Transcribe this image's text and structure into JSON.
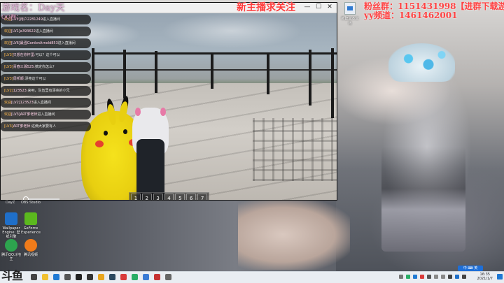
{
  "overlay": {
    "top_left": "游戏名：Day天",
    "top_left_sub": "QQ群：",
    "title_center": "新主播求关注",
    "qq_line": "粉丝群：1151431998【进群下载游戏】",
    "yy_line": "yy频道：1461462001"
  },
  "game_window": {
    "minimize": "—",
    "maximize": "☐",
    "close": "✕"
  },
  "hotbar": [
    "1",
    "2",
    "3",
    "4",
    "5",
    "6",
    "7"
  ],
  "chat": [
    {
      "lvl": "欢迎",
      "nick": "[LV2]用户2281249",
      "text": "进入直播间"
    },
    {
      "lvl": "欢迎",
      "nick": "[LV1]a393622",
      "text": "进入直播间"
    },
    {
      "lvl": "欢迎",
      "nick": "[LV6]最强GordonArnold853",
      "text": "进入直播间"
    },
    {
      "lvl": "[LV3]",
      "nick": "只想在你怀里:",
      "text": "可以？这个可以"
    },
    {
      "lvl": "[LV3]",
      "nick": "青春三湘525:",
      "text": "搞定你怎么？"
    },
    {
      "lvl": "[LV3]",
      "nick": "周邦顺:",
      "text": "漂亮这个可以"
    },
    {
      "lvl": "[LV2]",
      "nick": "123523:",
      "text": "来吧，队伍里有漂亮的小兄"
    },
    {
      "lvl": "欢迎",
      "nick": "[LV2]123523",
      "text": "进入直播间"
    },
    {
      "lvl": "欢迎",
      "nick": "[LV3]ART爹老师",
      "text": "进入直播间"
    },
    {
      "lvl": "[LV3]",
      "nick": "ART爹老师:",
      "text": "这俩大家要有人"
    }
  ],
  "desktop": {
    "day_label": "DayZ",
    "obs_label": "OBS Studio",
    "icons": [
      {
        "label": "Wallpaper Engine: 壁纸引擎",
        "color": "#1f6fc9"
      },
      {
        "label": "GeForce Experience",
        "color": "#5bb81e"
      },
      {
        "label": "腾讯QQ斗地主",
        "color": "#2da44e"
      },
      {
        "label": "腾讯视频",
        "color": "#f07b1a"
      }
    ],
    "file_icon_label": "新建文本文档"
  },
  "taskbar": {
    "start_label": "斗鱼",
    "ime": "中 ⌨ 英",
    "time": "16:35",
    "date": "2021/1/7",
    "apps": [
      {
        "name": "search-app",
        "color": "#444"
      },
      {
        "name": "explorer-app",
        "color": "#f0c030"
      },
      {
        "name": "edge-app",
        "color": "#1f7ad4"
      },
      {
        "name": "store-app",
        "color": "#555"
      },
      {
        "name": "qq-app",
        "color": "#222"
      },
      {
        "name": "obs-app",
        "color": "#333"
      },
      {
        "name": "chrome-app",
        "color": "#e8a51d"
      },
      {
        "name": "steam-app",
        "color": "#2a475e"
      },
      {
        "name": "game-app",
        "color": "#d93a3a"
      },
      {
        "name": "wechat-app",
        "color": "#2aae67"
      },
      {
        "name": "folder-app",
        "color": "#3a7bd5"
      },
      {
        "name": "music-app",
        "color": "#c73232"
      },
      {
        "name": "settings-app",
        "color": "#666"
      }
    ]
  }
}
